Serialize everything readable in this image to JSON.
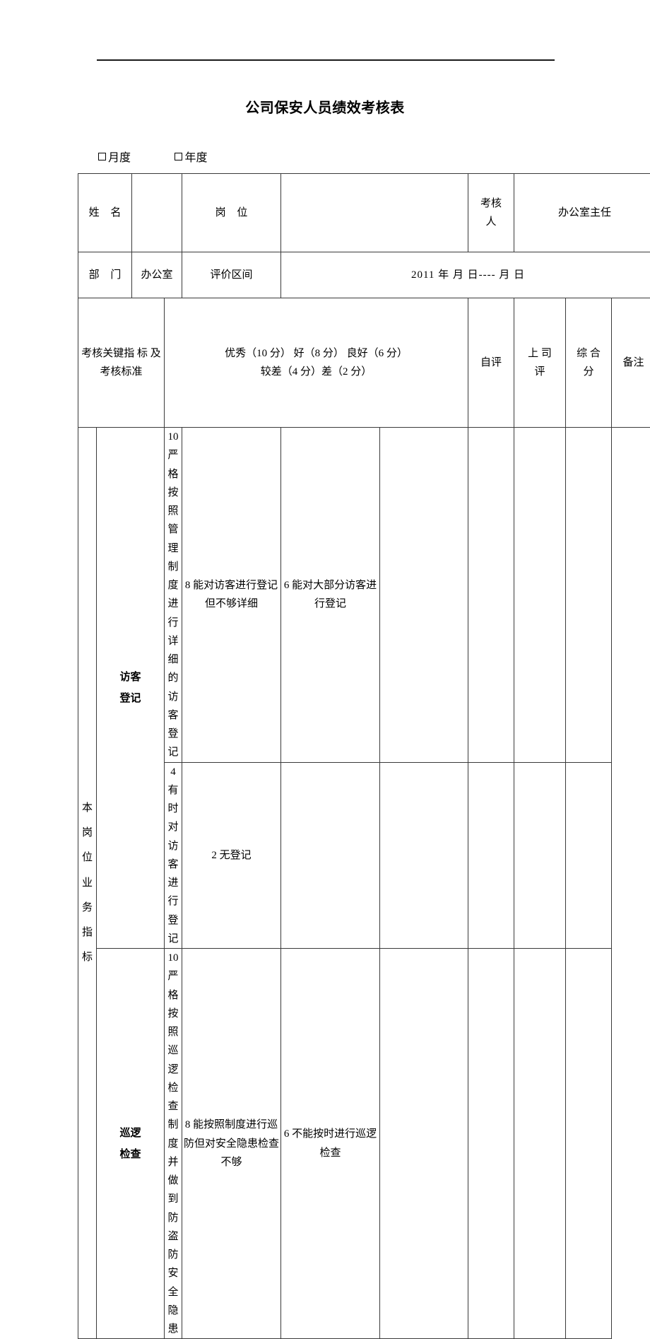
{
  "document": {
    "title": "公司保安人员绩效考核表",
    "period_options": [
      {
        "label": "月度",
        "checked": false
      },
      {
        "label": "年度",
        "checked": false
      }
    ]
  },
  "info": {
    "name_label": "姓 名",
    "name_value": "",
    "position_label": "岗 位",
    "position_value": "",
    "appraiser_label": "考核\n人",
    "appraiser_label_line1": "考核",
    "appraiser_label_line2": "人",
    "appraiser_value": "办公室主任",
    "department_label": "部 门",
    "department_value": "办公室",
    "eval_range_label": "评价区间",
    "eval_range_value": "2011 年    月  日----     月    日"
  },
  "table_header": {
    "key_indicator_line1": "考核关键指",
    "key_indicator_line2": "标",
    "key_indicator_line3": "及考核标准",
    "scoring_line1": "优秀（10 分）  好（8 分）  良好（6 分）",
    "scoring_line2": "较差（4 分）差（2 分）",
    "self_eval": "自评",
    "supervisor_eval_line1": "上  司",
    "supervisor_eval_line2": "评",
    "composite_line1": "综  合",
    "composite_line2": "分",
    "remarks": "备注"
  },
  "category": {
    "vertical_label_chars": [
      "本",
      "岗",
      "位",
      "业",
      "务",
      "指",
      "标"
    ],
    "vertical_label": "本岗位业务指标"
  },
  "criteria": [
    {
      "name_line1": "访客",
      "name_line2": "登记",
      "name": "访客登记",
      "rows": [
        {
          "levels": [
            "10 严格按照管理制度进行详细的访客登记",
            "8 能对访客进行登记但不够详细",
            "6 能对大部分访客进行登记"
          ],
          "self_eval": "",
          "supervisor_eval": "",
          "composite": "",
          "remarks": ""
        },
        {
          "levels": [
            "4 有时对访客进行登记",
            "2 无登记",
            ""
          ],
          "self_eval": "",
          "supervisor_eval": "",
          "composite": "",
          "remarks": ""
        }
      ]
    },
    {
      "name_line1": "巡逻",
      "name_line2": "检查",
      "name": "巡逻检查",
      "rows": [
        {
          "levels": [
            "10 严格按照巡逻检查制度并做到防盗防安全隐患",
            "8 能按照制度进行巡防但对安全隐患检查不够",
            "6 不能按时进行巡逻检查"
          ],
          "self_eval": "",
          "supervisor_eval": "",
          "composite": "",
          "remarks": ""
        }
      ]
    }
  ]
}
